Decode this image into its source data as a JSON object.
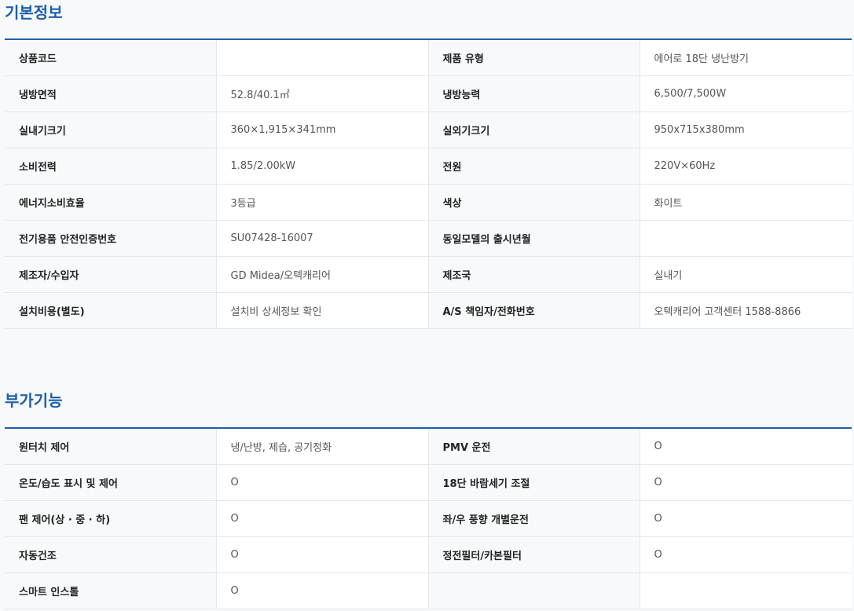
{
  "basic": {
    "title": "기본정보",
    "rows": [
      [
        "상품코드",
        "",
        "제품 유형",
        "에어로 18단 냉난방기"
      ],
      [
        "냉방면적",
        "52.8/40.1㎡",
        "냉방능력",
        "6,500/7,500W"
      ],
      [
        "실내기크기",
        "360×1,915×341mm",
        "실외기크기",
        "950x715x380mm"
      ],
      [
        "소비전력",
        "1.85/2.00kW",
        "전원",
        "220V×60Hz"
      ],
      [
        "에너지소비효율",
        "3등급",
        "색상",
        "화이트"
      ],
      [
        "전기용품 안전인증번호",
        "SU07428-16007",
        "동일모델의 출시년월",
        ""
      ],
      [
        "제조자/수입자",
        "GD Midea/오텍캐리어",
        "제조국",
        "실내기"
      ],
      [
        "설치비용(별도)",
        "설치비 상세정보 확인",
        "A/S 책임자/전화번호",
        "오텍캐리어 고객센터 1588-8866"
      ]
    ]
  },
  "extra": {
    "title": "부가기능",
    "rows": [
      [
        "원터치 제어",
        "냉/난방, 제습, 공기정화",
        "PMV 운전",
        "O"
      ],
      [
        "온도/습도 표시 및 제어",
        "O",
        "18단 바람세기 조절",
        "O"
      ],
      [
        "팬 제어(상 · 중 · 하)",
        "O",
        "좌/우 풍향 개별운전",
        "O"
      ],
      [
        "자동건조",
        "O",
        "정전필터/카본필터",
        "O"
      ],
      [
        "스마트 인스톨",
        "O",
        "",
        ""
      ]
    ]
  }
}
